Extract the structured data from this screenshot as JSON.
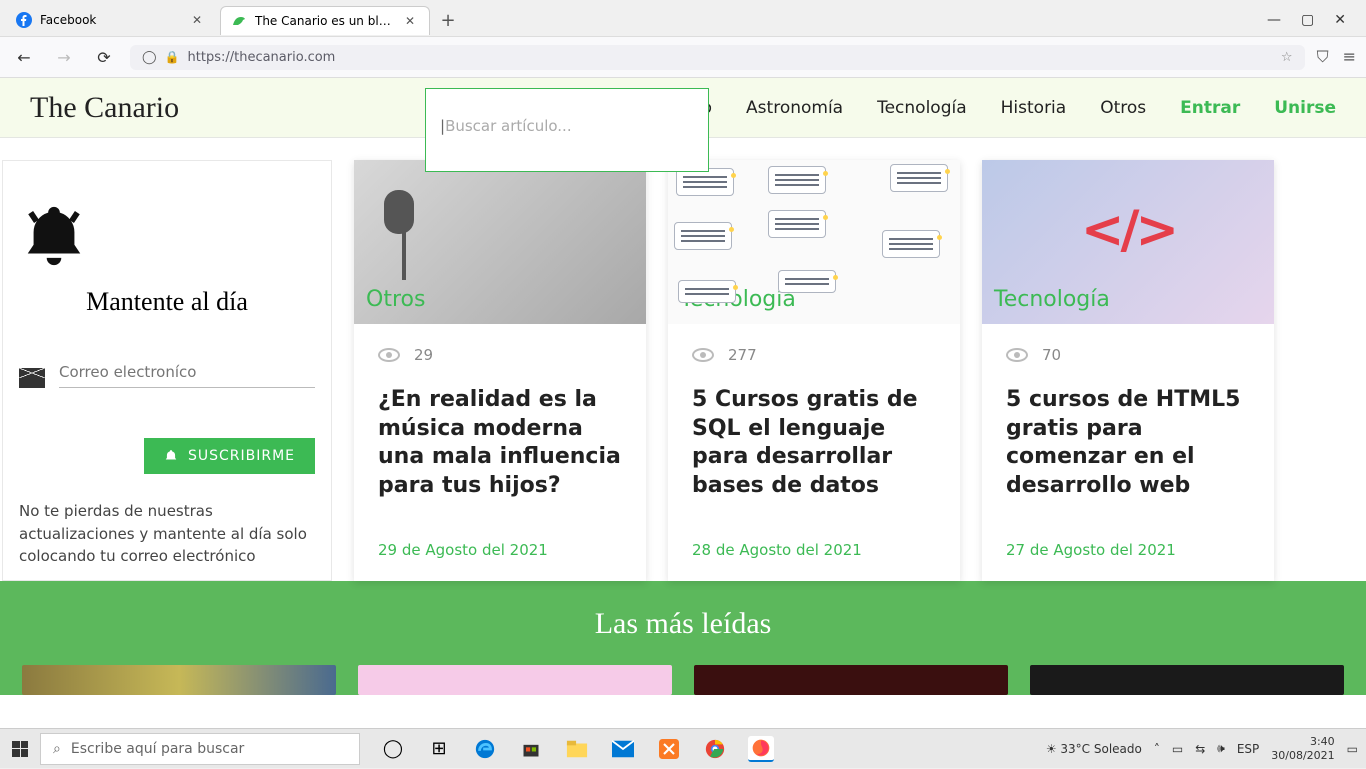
{
  "browser": {
    "tabs": [
      {
        "title": "Facebook",
        "active": false
      },
      {
        "title": "The Canario es un blog educati",
        "active": true
      }
    ],
    "url": "https://thecanario.com"
  },
  "site": {
    "brand": "The Canario",
    "nav": {
      "inicio": "Inicio",
      "astronomia": "Astronomía",
      "tecnologia": "Tecnología",
      "historia": "Historia",
      "otros": "Otros",
      "entrar": "Entrar",
      "unirse": "Unirse"
    },
    "search_placeholder": "Buscar artículo..."
  },
  "sidebar": {
    "heading": "Mantente al día",
    "email_placeholder": "Correo electroníco",
    "subscribe_label": "SUSCRIBIRME",
    "note": "No te pierdas de nuestras actualizaciones y mantente al día solo colocando tu correo electrónico"
  },
  "articles": [
    {
      "category": "Otros",
      "views": "29",
      "title": "¿En realidad es la música moderna una mala influencia para tus hijos?",
      "date": "29 de Agosto del 2021"
    },
    {
      "category": "Tecnología",
      "views": "277",
      "title": "5 Cursos gratis de SQL el lenguaje para desarrollar bases de datos",
      "date": "28 de Agosto del 2021"
    },
    {
      "category": "Tecnología",
      "views": "70",
      "title": "5 cursos de HTML5 gratis para comenzar en el desarrollo web",
      "date": "27 de Agosto del 2021"
    }
  ],
  "most_read_heading": "Las más leídas",
  "taskbar": {
    "search_placeholder": "Escribe aquí para buscar",
    "weather": "33°C  Soleado",
    "lang": "ESP",
    "time": "3:40",
    "date": "30/08/2021"
  }
}
